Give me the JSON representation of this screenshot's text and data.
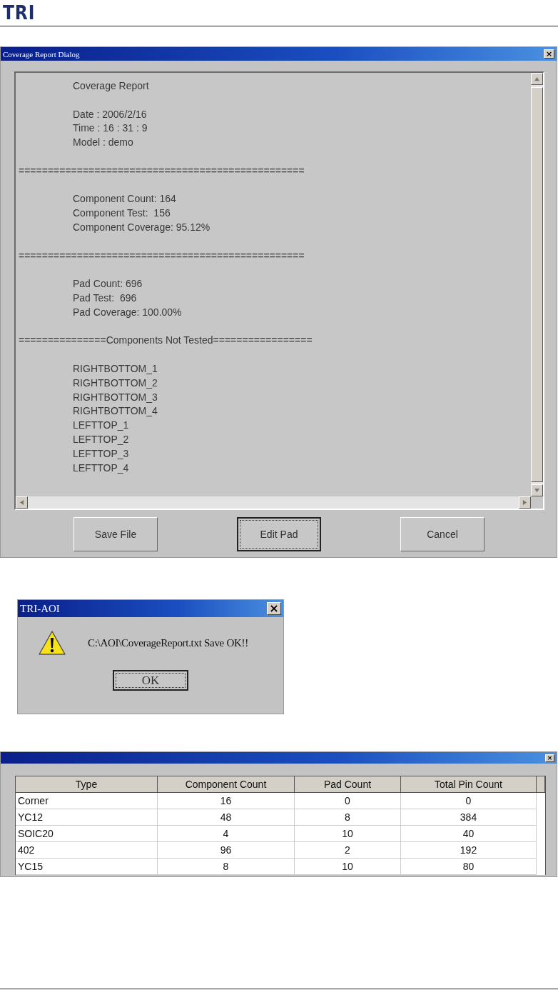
{
  "header": {
    "logo": "TRI"
  },
  "report_dialog": {
    "title": "Coverage Report Dialog",
    "close": "×",
    "sections": [
      {
        "kind": "indented",
        "lines": [
          "Coverage Report"
        ]
      },
      {
        "kind": "indented",
        "lines": [
          "Date : 2006/2/16",
          "Time : 16 : 31 : 9",
          "Model : demo"
        ]
      },
      {
        "kind": "separator",
        "lines": [
          "================================================="
        ]
      },
      {
        "kind": "indented",
        "lines": [
          "Component Count: 164",
          "Component Test:  156",
          "Component Coverage: 95.12%"
        ]
      },
      {
        "kind": "separator",
        "lines": [
          "================================================="
        ]
      },
      {
        "kind": "indented",
        "lines": [
          "Pad Count: 696",
          "Pad Test:  696",
          "Pad Coverage: 100.00%"
        ]
      },
      {
        "kind": "separator",
        "lines": [
          "===============Components Not Tested================="
        ]
      },
      {
        "kind": "indented",
        "lines": [
          "RIGHTBOTTOM_1",
          "RIGHTBOTTOM_2",
          "RIGHTBOTTOM_3",
          "RIGHTBOTTOM_4",
          "LEFTTOP_1",
          "LEFTTOP_2",
          "LEFTTOP_3",
          "LEFTTOP_4"
        ]
      }
    ],
    "buttons": [
      {
        "label": "Save File",
        "focused": false
      },
      {
        "label": "Edit Pad",
        "focused": true
      },
      {
        "label": "Cancel",
        "focused": false
      }
    ]
  },
  "message_box": {
    "title": "TRI-AOI",
    "close": "×",
    "message": "C:\\AOI\\CoverageReport.txt Save OK!!",
    "button": {
      "label": "OK",
      "focused": true
    }
  },
  "pad_dialog": {
    "close": "×",
    "columns": [
      "Type",
      "Component Count",
      "Pad Count",
      "Total Pin Count"
    ],
    "rows": [
      [
        "Corner",
        "16",
        "0",
        "0"
      ],
      [
        "YC12",
        "48",
        "8",
        "384"
      ],
      [
        "SOIC20",
        "4",
        "10",
        "40"
      ],
      [
        "402",
        "96",
        "2",
        "192"
      ],
      [
        "YC15",
        "8",
        "10",
        "80"
      ]
    ]
  }
}
